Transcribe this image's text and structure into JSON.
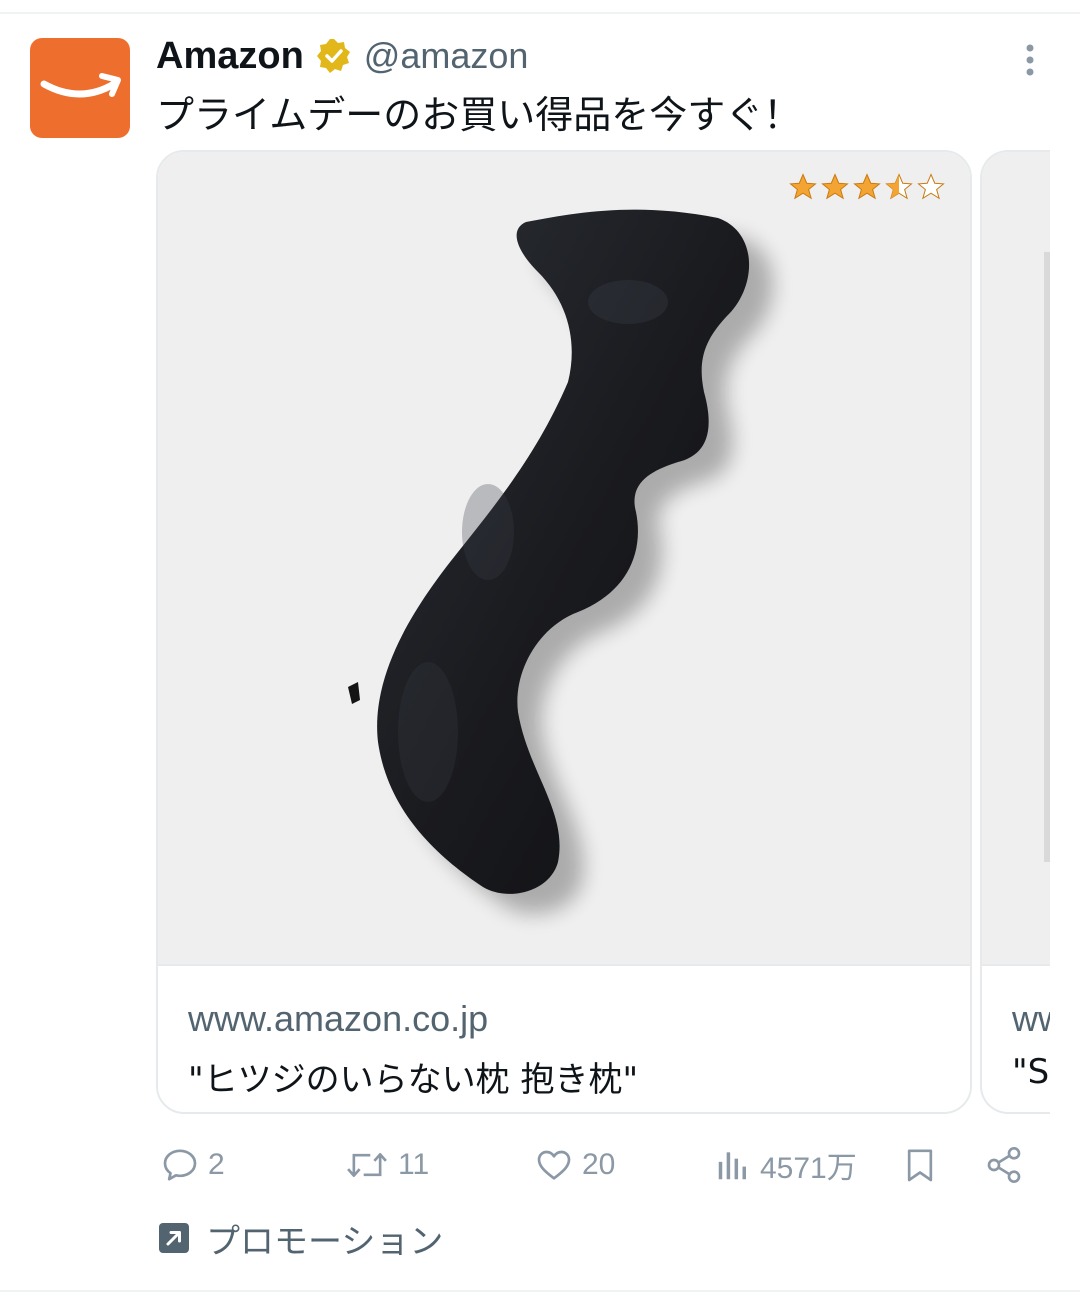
{
  "tweet": {
    "display_name": "Amazon",
    "handle": "@amazon",
    "text": "プライムデーのお買い得品を今すぐ！",
    "verified": true,
    "brand_color": "#ee6e2e"
  },
  "card": {
    "domain": "www.amazon.co.jp",
    "title": "\"ヒツジのいらない枕 抱き枕\"",
    "rating": 3.5,
    "rating_max": 5
  },
  "card_next": {
    "domain_partial": "ww",
    "title_partial": "\"S"
  },
  "actions": {
    "replies": "2",
    "reposts": "11",
    "likes": "20",
    "views": "4571万"
  },
  "promo": {
    "label": "プロモーション"
  },
  "icons": [
    "verified-badge-icon",
    "more-icon",
    "reply-icon",
    "repost-icon",
    "like-icon",
    "views-icon",
    "bookmark-icon",
    "share-icon",
    "promoted-icon",
    "star-icon"
  ]
}
